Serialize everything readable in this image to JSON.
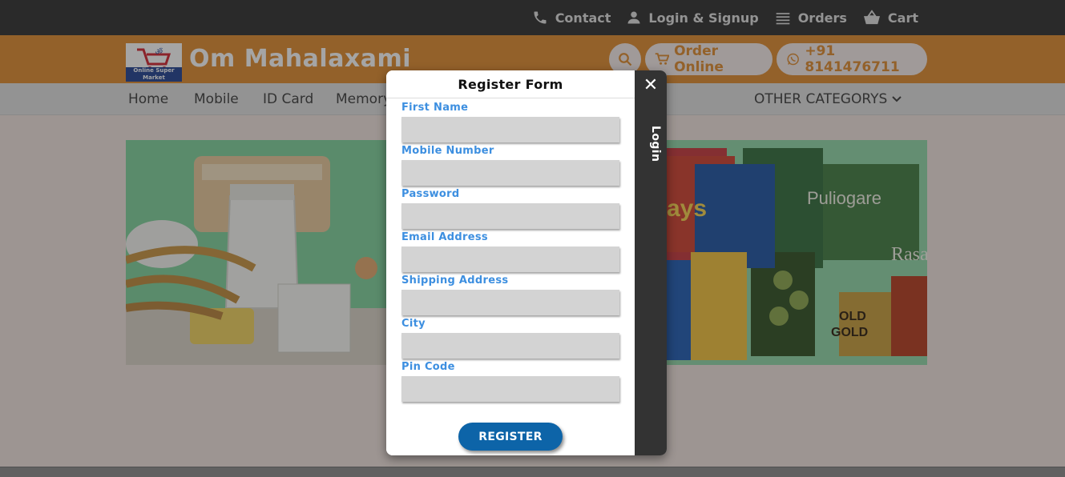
{
  "topnav": {
    "items": [
      {
        "label": "Contact",
        "icon": "phone-icon"
      },
      {
        "label": "Login & Signup",
        "icon": "user-icon"
      },
      {
        "label": "Orders",
        "icon": "list-icon"
      },
      {
        "label": "Cart",
        "icon": "basket-icon"
      }
    ]
  },
  "header": {
    "brand": "Om Mahalaxami",
    "logo_text": "Online Super Market",
    "order_online": "Order Online",
    "phone": "+91 8141476711"
  },
  "categories": {
    "items": [
      "Home",
      "Mobile",
      "ID Card",
      "Memory"
    ],
    "other": "OTHER CATEGORYS"
  },
  "modal": {
    "title": "Register Form",
    "side_tab": "Login",
    "fields": [
      {
        "label": "First Name",
        "value": ""
      },
      {
        "label": "Mobile Number",
        "value": ""
      },
      {
        "label": "Password",
        "value": ""
      },
      {
        "label": "Email Address",
        "value": ""
      },
      {
        "label": "Shipping Address",
        "value": ""
      },
      {
        "label": "City",
        "value": ""
      },
      {
        "label": "Pin Code",
        "value": ""
      }
    ],
    "submit": "REGISTER"
  },
  "colors": {
    "topbar": "#2b2b2b",
    "header": "#e08a2c",
    "label": "#3d8fe0",
    "button": "#0d64a8"
  }
}
